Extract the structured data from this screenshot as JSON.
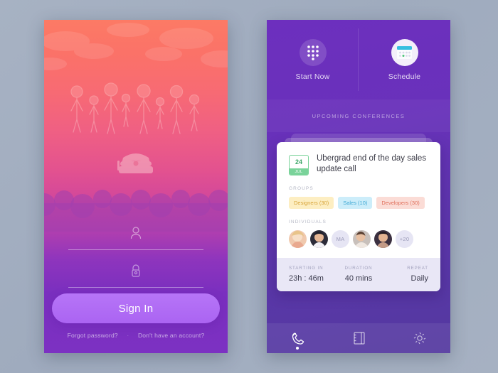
{
  "login_screen": {
    "name": "sign-in",
    "illustration": {
      "people_icon": "group-of-people-illustration",
      "phone_icon": "retro-telephone-illustration"
    },
    "username_field": {
      "value": "",
      "placeholder": "",
      "icon": "user-icon"
    },
    "password_field": {
      "value": "",
      "placeholder": "",
      "icon": "lock-icon"
    },
    "sign_in_button": "Sign In",
    "footer": {
      "forgot": "Forgot password?",
      "separator": "·",
      "signup": "Don't have an account?"
    },
    "colors": {
      "top": "#FB7268",
      "bottom": "#7C31C2",
      "button": "#B675F7"
    }
  },
  "conference_screen": {
    "quick_actions": [
      {
        "label": "Start Now",
        "icon": "dialpad-icon"
      },
      {
        "label": "Schedule",
        "icon": "calendar-icon"
      }
    ],
    "section_header": "UPCOMING CONFERENCES",
    "card": {
      "date": {
        "day": "24",
        "month": "JUL"
      },
      "title": "Ubergrad end of the day sales update call",
      "groups_label": "GROUPS",
      "groups": [
        {
          "label": "Designers (30)",
          "color": "#D8A53B",
          "bg": "#FDEEC2"
        },
        {
          "label": "Sales (10)",
          "color": "#3FA9D4",
          "bg": "#CCEDFA"
        },
        {
          "label": "Developers (30)",
          "color": "#E0705C",
          "bg": "#FBDCD6"
        }
      ],
      "individuals_label": "INDIVIDUALS",
      "individuals": [
        {
          "type": "photo",
          "label": ""
        },
        {
          "type": "photo",
          "label": ""
        },
        {
          "type": "initials",
          "label": "MA"
        },
        {
          "type": "photo",
          "label": ""
        },
        {
          "type": "photo",
          "label": ""
        },
        {
          "type": "more",
          "label": "+20"
        }
      ],
      "stats": [
        {
          "label": "STARTING IN",
          "value": "23h : 46m"
        },
        {
          "label": "DURATION",
          "value": "40 mins"
        },
        {
          "label": "REPEAT",
          "value": "Daily"
        }
      ]
    },
    "tabs": [
      {
        "icon": "phone-call-icon",
        "active": true
      },
      {
        "icon": "contacts-book-icon",
        "active": false
      },
      {
        "icon": "settings-gear-icon",
        "active": false
      }
    ],
    "colors": {
      "background": "#6B2FBA",
      "card_footer": "#E9E7F6"
    }
  }
}
